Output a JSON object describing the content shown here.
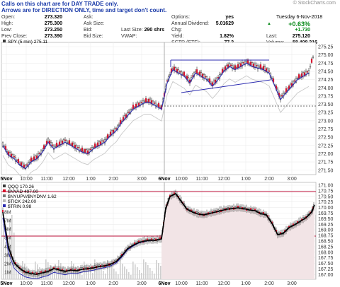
{
  "notes": {
    "line1": "Calls on this chart are for DAY TRADE only.",
    "line2": "Arrows are for DIRECTION ONLY, time and target don't count."
  },
  "brand": "© StockCharts.com",
  "quote": {
    "date": "Tuesday 6-Nov-2018",
    "chg_pct": "+0.63%",
    "rows": [
      {
        "l1": "Open:",
        "v1": "273.320",
        "l2": "Ask:",
        "v2": "",
        "l3": "Options:",
        "v3": "yes",
        "l4": "",
        "v4": ""
      },
      {
        "l1": "High:",
        "v1": "275.300",
        "l2": "Ask Size:",
        "v2": "",
        "l3": "Annual Dividend:",
        "v3": "5.01629",
        "l4": "Chg:",
        "v4": "+1.730"
      },
      {
        "l1": "Low:",
        "v1": "273.250",
        "l2": "Bid:",
        "v2": "",
        "l3": "Last Size:",
        "v3": "290 shrs",
        "l4": "Yield:",
        "v4": "1.82%",
        "l5": "Last:",
        "v5": "275.120"
      },
      {
        "l1": "Prev Close:",
        "v1": "273.390",
        "l2": "Bid Size:",
        "v2": "",
        "l3": "VWAP:",
        "v3": "",
        "l4": "SCTR (ETF):",
        "v4": "77.2",
        "l5": "Volume:",
        "v5": "58,498,216"
      }
    ]
  },
  "price_panel": {
    "legend": "SPY (5 min) 275.11",
    "y_labels": [
      "275.25",
      "275.00",
      "274.75",
      "274.50",
      "274.25",
      "274.00",
      "273.75",
      "273.50",
      "273.25",
      "273.00",
      "272.75",
      "272.50",
      "272.25",
      "272.00",
      "271.75",
      "271.50"
    ],
    "x_labels": [
      "5Nov",
      "10:00",
      "11:00",
      "12:00",
      "1:00",
      "2:00",
      "3:00",
      "6Nov",
      "10:00",
      "11:00",
      "12:00",
      "1:00",
      "2:00",
      "3:00"
    ]
  },
  "lower_panel": {
    "legend": [
      "QQQ 170.26",
      "$NYAD 497.00",
      "$NYUPV/$NYDNV 1.62",
      "$TICK 242.00",
      "$TRIN 0.98"
    ],
    "y_labels_right": [
      "171.00",
      "170.75",
      "170.50",
      "170.25",
      "170.00",
      "169.75",
      "169.50",
      "169.25",
      "169.00",
      "168.75",
      "168.50",
      "168.25",
      "168.00",
      "167.75",
      "167.50",
      "167.25",
      "167.00"
    ],
    "y_labels_left": [
      "8M",
      "7M",
      "6M",
      "5M",
      "4M",
      "3M",
      "2M",
      "1M"
    ],
    "x_labels": [
      "5Nov",
      "10:00",
      "11:00",
      "12:00",
      "1:00",
      "2:00",
      "3:00",
      "6Nov",
      "10:00",
      "11:00",
      "12:00",
      "1:00",
      "2:00",
      "3:00"
    ]
  },
  "colors": {
    "up": "#0a8a1a",
    "note": "#1a3aa8",
    "candle_down": "#d8102a",
    "ma": "#2b2bb0",
    "hline": "#c0143c"
  }
}
